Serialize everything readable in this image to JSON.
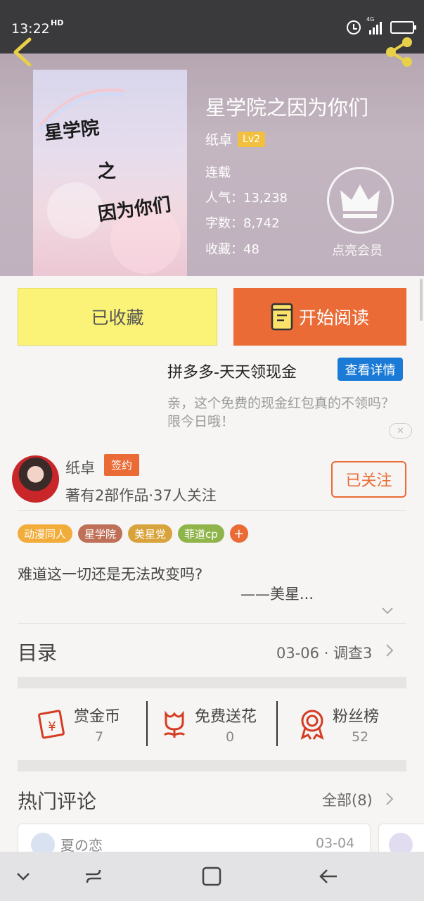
{
  "status_bar": {
    "time": "13:22",
    "hd": "HD",
    "network": "4G"
  },
  "book": {
    "title": "星学院之因为你们",
    "cover_lines": [
      "星学院",
      "之",
      "因为你们"
    ],
    "author": "纸卓",
    "level": "Lv2",
    "status": "连载",
    "popularity_label": "人气：",
    "popularity": "13,238",
    "words_label": "字数：",
    "words": "8,742",
    "favorites_label": "收藏：",
    "favorites": "48",
    "vip_label": "点亮会员"
  },
  "actions": {
    "collected": "已收藏",
    "start_reading": "开始阅读"
  },
  "ad": {
    "title": "拼多多-天天领现金",
    "details_button": "查看详情",
    "description": "亲，这个免费的现金红包真的不领吗？限今日哦！",
    "close": "✕"
  },
  "author_card": {
    "name": "纸卓",
    "badge": "签约",
    "stats": "著有2部作品·37人关注",
    "follow_button": "已关注"
  },
  "tags": [
    {
      "label": "动漫同人",
      "color": "#f2ac3a"
    },
    {
      "label": "星学院",
      "color": "#bf7058"
    },
    {
      "label": "美星党",
      "color": "#d9a33b"
    },
    {
      "label": "菲道cp",
      "color": "#8fb54a"
    }
  ],
  "tag_more": "+",
  "synopsis": {
    "line1": "难道这一切还是无法改变吗?",
    "line2": "——美星..."
  },
  "toc": {
    "label": "目录",
    "info": "03-06 · 调查3"
  },
  "stats": [
    {
      "label": "赏金币",
      "value": "7",
      "icon": "money-envelope-icon"
    },
    {
      "label": "免费送花",
      "value": "0",
      "icon": "flower-icon"
    },
    {
      "label": "粉丝榜",
      "value": "52",
      "icon": "medal-icon"
    }
  ],
  "comments": {
    "label": "热门评论",
    "all": "全部(8)",
    "items": [
      {
        "user": "夏の恋",
        "date": "03-04"
      }
    ]
  },
  "colors": {
    "accent": "#ea6b35",
    "collected_bg": "#fbf377",
    "ad_button": "#1a7ad6"
  }
}
